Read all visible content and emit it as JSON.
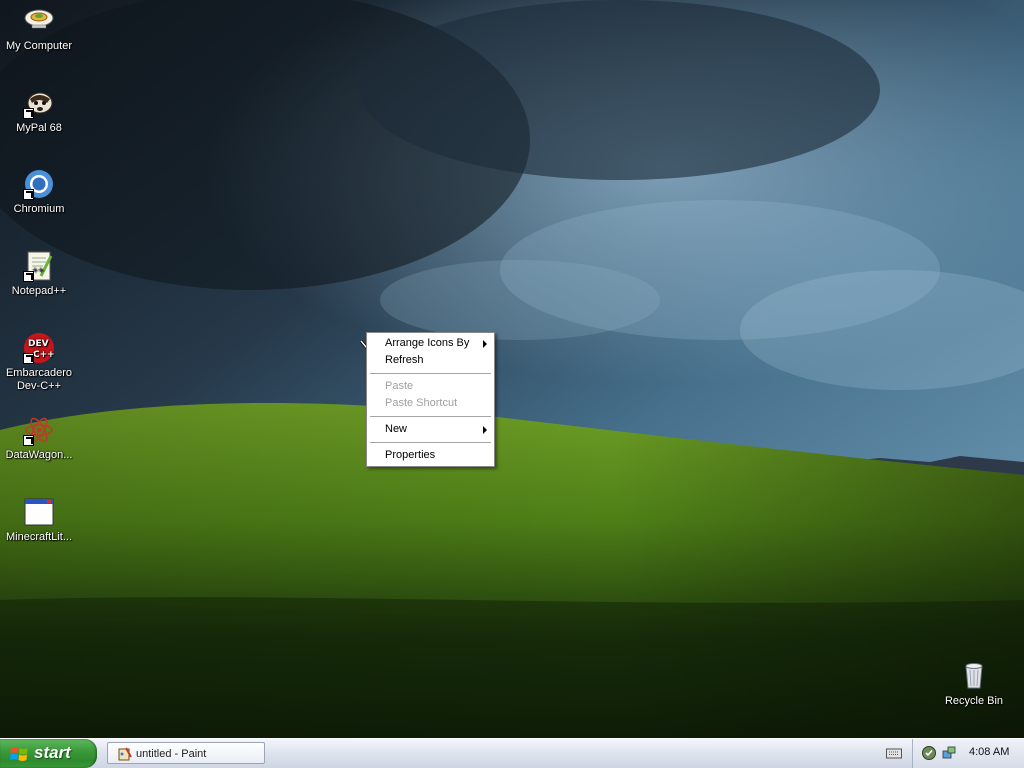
{
  "desktop": {
    "icons": [
      {
        "label": "My Computer",
        "icon": "my-computer-icon"
      },
      {
        "label": "MyPal 68",
        "icon": "mypal-icon"
      },
      {
        "label": "Chromium",
        "icon": "chromium-icon"
      },
      {
        "label": "Notepad++",
        "icon": "notepadpp-icon"
      },
      {
        "label": "Embarcadero\nDev-C++",
        "icon": "devcpp-icon"
      },
      {
        "label": "DataWagon...",
        "icon": "datawagon-icon"
      },
      {
        "label": "MinecraftLit...",
        "icon": "minecraftlite-icon"
      },
      {
        "label": "Recycle Bin",
        "icon": "recycle-bin-icon"
      }
    ]
  },
  "context_menu": {
    "items": [
      {
        "label": "Arrange Icons By",
        "submenu": true,
        "disabled": false
      },
      {
        "label": "Refresh",
        "submenu": false,
        "disabled": false
      },
      {
        "label": "Paste",
        "submenu": false,
        "disabled": true
      },
      {
        "label": "Paste Shortcut",
        "submenu": false,
        "disabled": true
      },
      {
        "label": "New",
        "submenu": true,
        "disabled": false
      },
      {
        "label": "Properties",
        "submenu": false,
        "disabled": false
      }
    ]
  },
  "taskbar": {
    "start_label": "start",
    "tasks": [
      {
        "label": "untitled - Paint",
        "icon": "paint-icon"
      }
    ],
    "tray_icons": [
      "security-shield-icon",
      "network-icon"
    ],
    "clock": "4:08 AM"
  },
  "colors": {
    "start_green": "#3c9b3c",
    "taskbar_bg": "#dfe4ee",
    "menu_disabled_text": "#a0a0a0"
  }
}
